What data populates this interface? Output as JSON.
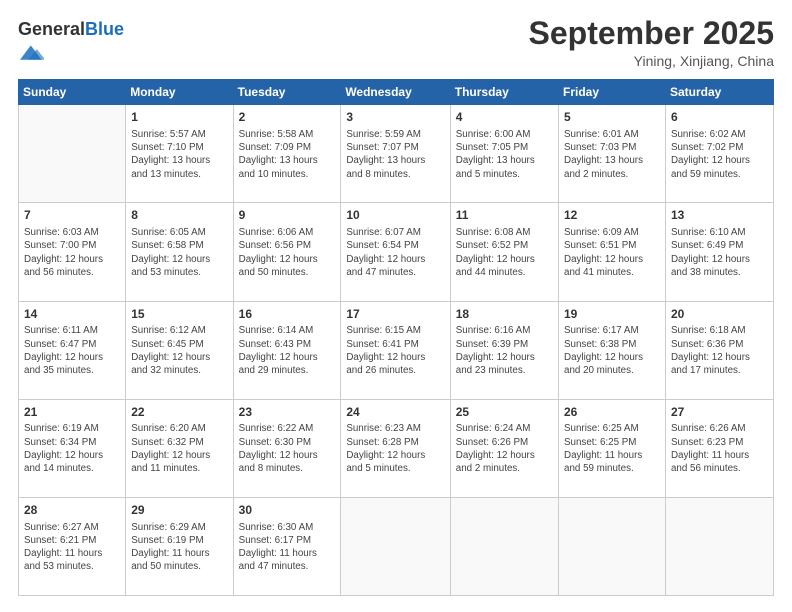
{
  "header": {
    "logo_general": "General",
    "logo_blue": "Blue",
    "month_title": "September 2025",
    "location": "Yining, Xinjiang, China"
  },
  "days_of_week": [
    "Sunday",
    "Monday",
    "Tuesday",
    "Wednesday",
    "Thursday",
    "Friday",
    "Saturday"
  ],
  "weeks": [
    [
      {
        "day": "",
        "content": ""
      },
      {
        "day": "1",
        "content": "Sunrise: 5:57 AM\nSunset: 7:10 PM\nDaylight: 13 hours\nand 13 minutes."
      },
      {
        "day": "2",
        "content": "Sunrise: 5:58 AM\nSunset: 7:09 PM\nDaylight: 13 hours\nand 10 minutes."
      },
      {
        "day": "3",
        "content": "Sunrise: 5:59 AM\nSunset: 7:07 PM\nDaylight: 13 hours\nand 8 minutes."
      },
      {
        "day": "4",
        "content": "Sunrise: 6:00 AM\nSunset: 7:05 PM\nDaylight: 13 hours\nand 5 minutes."
      },
      {
        "day": "5",
        "content": "Sunrise: 6:01 AM\nSunset: 7:03 PM\nDaylight: 13 hours\nand 2 minutes."
      },
      {
        "day": "6",
        "content": "Sunrise: 6:02 AM\nSunset: 7:02 PM\nDaylight: 12 hours\nand 59 minutes."
      }
    ],
    [
      {
        "day": "7",
        "content": "Sunrise: 6:03 AM\nSunset: 7:00 PM\nDaylight: 12 hours\nand 56 minutes."
      },
      {
        "day": "8",
        "content": "Sunrise: 6:05 AM\nSunset: 6:58 PM\nDaylight: 12 hours\nand 53 minutes."
      },
      {
        "day": "9",
        "content": "Sunrise: 6:06 AM\nSunset: 6:56 PM\nDaylight: 12 hours\nand 50 minutes."
      },
      {
        "day": "10",
        "content": "Sunrise: 6:07 AM\nSunset: 6:54 PM\nDaylight: 12 hours\nand 47 minutes."
      },
      {
        "day": "11",
        "content": "Sunrise: 6:08 AM\nSunset: 6:52 PM\nDaylight: 12 hours\nand 44 minutes."
      },
      {
        "day": "12",
        "content": "Sunrise: 6:09 AM\nSunset: 6:51 PM\nDaylight: 12 hours\nand 41 minutes."
      },
      {
        "day": "13",
        "content": "Sunrise: 6:10 AM\nSunset: 6:49 PM\nDaylight: 12 hours\nand 38 minutes."
      }
    ],
    [
      {
        "day": "14",
        "content": "Sunrise: 6:11 AM\nSunset: 6:47 PM\nDaylight: 12 hours\nand 35 minutes."
      },
      {
        "day": "15",
        "content": "Sunrise: 6:12 AM\nSunset: 6:45 PM\nDaylight: 12 hours\nand 32 minutes."
      },
      {
        "day": "16",
        "content": "Sunrise: 6:14 AM\nSunset: 6:43 PM\nDaylight: 12 hours\nand 29 minutes."
      },
      {
        "day": "17",
        "content": "Sunrise: 6:15 AM\nSunset: 6:41 PM\nDaylight: 12 hours\nand 26 minutes."
      },
      {
        "day": "18",
        "content": "Sunrise: 6:16 AM\nSunset: 6:39 PM\nDaylight: 12 hours\nand 23 minutes."
      },
      {
        "day": "19",
        "content": "Sunrise: 6:17 AM\nSunset: 6:38 PM\nDaylight: 12 hours\nand 20 minutes."
      },
      {
        "day": "20",
        "content": "Sunrise: 6:18 AM\nSunset: 6:36 PM\nDaylight: 12 hours\nand 17 minutes."
      }
    ],
    [
      {
        "day": "21",
        "content": "Sunrise: 6:19 AM\nSunset: 6:34 PM\nDaylight: 12 hours\nand 14 minutes."
      },
      {
        "day": "22",
        "content": "Sunrise: 6:20 AM\nSunset: 6:32 PM\nDaylight: 12 hours\nand 11 minutes."
      },
      {
        "day": "23",
        "content": "Sunrise: 6:22 AM\nSunset: 6:30 PM\nDaylight: 12 hours\nand 8 minutes."
      },
      {
        "day": "24",
        "content": "Sunrise: 6:23 AM\nSunset: 6:28 PM\nDaylight: 12 hours\nand 5 minutes."
      },
      {
        "day": "25",
        "content": "Sunrise: 6:24 AM\nSunset: 6:26 PM\nDaylight: 12 hours\nand 2 minutes."
      },
      {
        "day": "26",
        "content": "Sunrise: 6:25 AM\nSunset: 6:25 PM\nDaylight: 11 hours\nand 59 minutes."
      },
      {
        "day": "27",
        "content": "Sunrise: 6:26 AM\nSunset: 6:23 PM\nDaylight: 11 hours\nand 56 minutes."
      }
    ],
    [
      {
        "day": "28",
        "content": "Sunrise: 6:27 AM\nSunset: 6:21 PM\nDaylight: 11 hours\nand 53 minutes."
      },
      {
        "day": "29",
        "content": "Sunrise: 6:29 AM\nSunset: 6:19 PM\nDaylight: 11 hours\nand 50 minutes."
      },
      {
        "day": "30",
        "content": "Sunrise: 6:30 AM\nSunset: 6:17 PM\nDaylight: 11 hours\nand 47 minutes."
      },
      {
        "day": "",
        "content": ""
      },
      {
        "day": "",
        "content": ""
      },
      {
        "day": "",
        "content": ""
      },
      {
        "day": "",
        "content": ""
      }
    ]
  ]
}
